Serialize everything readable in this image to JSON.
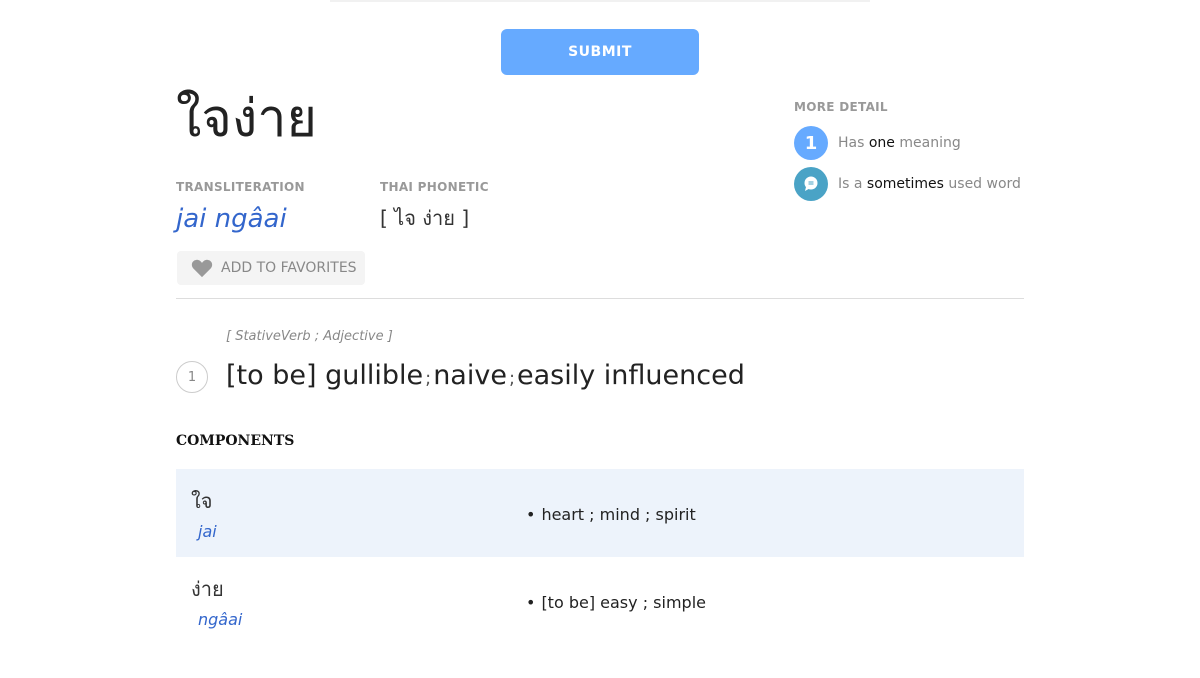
{
  "form": {
    "submit_label": "SUBMIT"
  },
  "entry": {
    "word": "ใจง่าย",
    "transliteration_label": "TRANSLITERATION",
    "transliteration": "jai ngâai",
    "phonetic_label": "THAI PHONETIC",
    "phonetic": "[ ไจ ง่าย ]",
    "favorites_label": "ADD TO FAVORITES",
    "favorites_icon": "heart-icon"
  },
  "more_detail": {
    "title": "MORE DETAIL",
    "meanings": {
      "count": "1",
      "prefix": "Has ",
      "emphasis": "one",
      "suffix": " meaning",
      "color": "#66aaff"
    },
    "frequency": {
      "prefix": "Is a ",
      "emphasis": "sometimes",
      "suffix": " used word",
      "color": "#4aa3c6",
      "icon": "speech-bubble-icon"
    }
  },
  "definition": {
    "number": "1",
    "part_of_speech": "[ StativeVerb ; Adjective ]",
    "senses": [
      "[to be] gullible",
      "naive",
      "easily influenced"
    ],
    "separator": ";"
  },
  "components": {
    "title": "COMPONENTS",
    "items": [
      {
        "thai": "ใจ",
        "roman": "jai",
        "meaning": "heart ; mind ; spirit"
      },
      {
        "thai": "ง่าย",
        "roman": "ngâai",
        "meaning": "[to be] easy ; simple"
      }
    ]
  }
}
